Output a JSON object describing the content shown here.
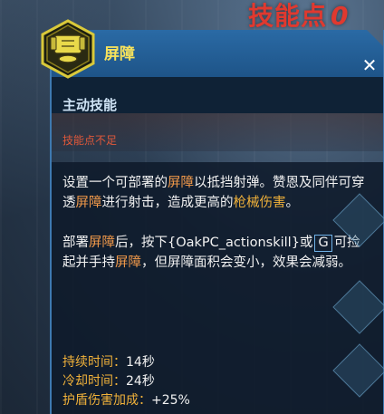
{
  "header": {
    "skill_points_label": "技能点",
    "skill_points_value": "0"
  },
  "card": {
    "title": "屏障",
    "close_glyph": "✕",
    "skill_type": "主动技能",
    "status": "技能点不足",
    "description": {
      "p1": [
        {
          "text": "设置一个可部署的"
        },
        {
          "text": "屏障",
          "style": "orange"
        },
        {
          "text": "以抵挡射弹。赞恩及同伴可穿透"
        },
        {
          "text": "屏障",
          "style": "orange"
        },
        {
          "text": "进行射击，造成更高的"
        },
        {
          "text": "枪械伤害",
          "style": "yellow"
        },
        {
          "text": "。"
        }
      ],
      "p2": [
        {
          "text": "部署"
        },
        {
          "text": "屏障",
          "style": "orange"
        },
        {
          "text": "后，按下{OakPC_actionskill}或"
        },
        {
          "text": "G",
          "style": "key"
        },
        {
          "text": "可捡起并手持"
        },
        {
          "text": "屏障",
          "style": "orange"
        },
        {
          "text": "，但屏障面积会变小，效果会减弱。"
        }
      ]
    },
    "stats": [
      {
        "label": "持续时间：",
        "value": "14秒"
      },
      {
        "label": "冷却时间：",
        "value": "24秒"
      },
      {
        "label": "护盾伤害加成：",
        "value": "+25%"
      }
    ]
  },
  "colors": {
    "accent": "#f7e25c",
    "highlight_orange": "#f39a4a",
    "highlight_yellow": "#f0b13a",
    "warning": "#e0583a",
    "panel_blue": "#1e5488"
  },
  "icons": {
    "skill_icon": "barrier-shield-icon",
    "close": "close-icon"
  }
}
